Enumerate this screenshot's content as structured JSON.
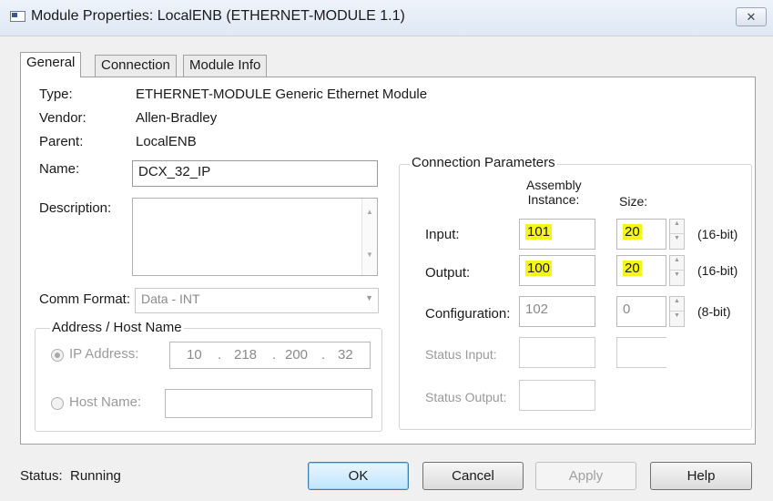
{
  "window": {
    "title": "Module Properties: LocalENB (ETHERNET-MODULE 1.1)",
    "close_glyph": "✕"
  },
  "tabs": [
    {
      "label": "General"
    },
    {
      "label": "Connection"
    },
    {
      "label": "Module Info"
    }
  ],
  "general": {
    "type_label": "Type:",
    "type_value": "ETHERNET-MODULE Generic Ethernet Module",
    "vendor_label": "Vendor:",
    "vendor_value": "Allen-Bradley",
    "parent_label": "Parent:",
    "parent_value": "LocalENB",
    "name_label": "Name:",
    "name_value": "DCX_32_IP",
    "description_label": "Description:",
    "description_value": "",
    "comm_format_label": "Comm Format:",
    "comm_format_value": "Data - INT"
  },
  "address": {
    "group_title": "Address / Host Name",
    "ip_label": "IP Address:",
    "ip_octets": [
      "10",
      "218",
      "200",
      "32"
    ],
    "ip_sep": ".",
    "ip_selected": true,
    "host_label": "Host Name:",
    "host_value": ""
  },
  "connection": {
    "group_title": "Connection Parameters",
    "col_instance_line1": "Assembly",
    "col_instance_line2": "Instance:",
    "col_size": "Size:",
    "rows": [
      {
        "label": "Input:",
        "instance": "101",
        "size": "20",
        "unit": "(16-bit)"
      },
      {
        "label": "Output:",
        "instance": "100",
        "size": "20",
        "unit": "(16-bit)"
      },
      {
        "label": "Configuration:",
        "instance": "102",
        "size": "0",
        "unit": "(8-bit)"
      },
      {
        "label": "Status Input:",
        "instance": "",
        "size": ""
      },
      {
        "label": "Status Output:",
        "instance": ""
      }
    ],
    "highlight_color": "#f5f519"
  },
  "status": {
    "label": "Status:",
    "value": "Running"
  },
  "buttons": {
    "ok": "OK",
    "cancel": "Cancel",
    "apply": "Apply",
    "help": "Help"
  }
}
